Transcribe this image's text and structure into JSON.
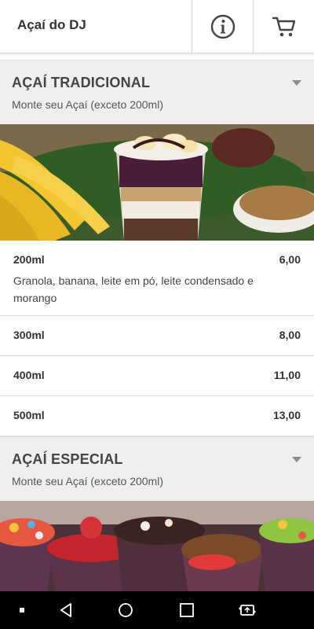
{
  "header": {
    "title": "Açaí do DJ",
    "info_icon": "info-circle-icon",
    "cart_icon": "shopping-cart-icon"
  },
  "sections": [
    {
      "title": "AÇAÍ TRADICIONAL",
      "subtitle": "Monte seu Açaí (exceto 200ml)",
      "items": [
        {
          "size": "200ml",
          "price": "6,00",
          "description": "Granola, banana, leite em pó, leite condensado e morango"
        },
        {
          "size": "300ml",
          "price": "8,00"
        },
        {
          "size": "400ml",
          "price": "11,00"
        },
        {
          "size": "500ml",
          "price": "13,00"
        }
      ]
    },
    {
      "title": "AÇAÍ ESPECIAL",
      "subtitle": "Monte seu Açaí (exceto 200ml)"
    }
  ],
  "navbar": {
    "icons": [
      "dot-icon",
      "back-icon",
      "home-icon",
      "recents-icon",
      "screen-rotate-icon"
    ]
  },
  "colors": {
    "section_bg": "#efefef",
    "navbar_bg": "#000000",
    "text": "#333333"
  }
}
